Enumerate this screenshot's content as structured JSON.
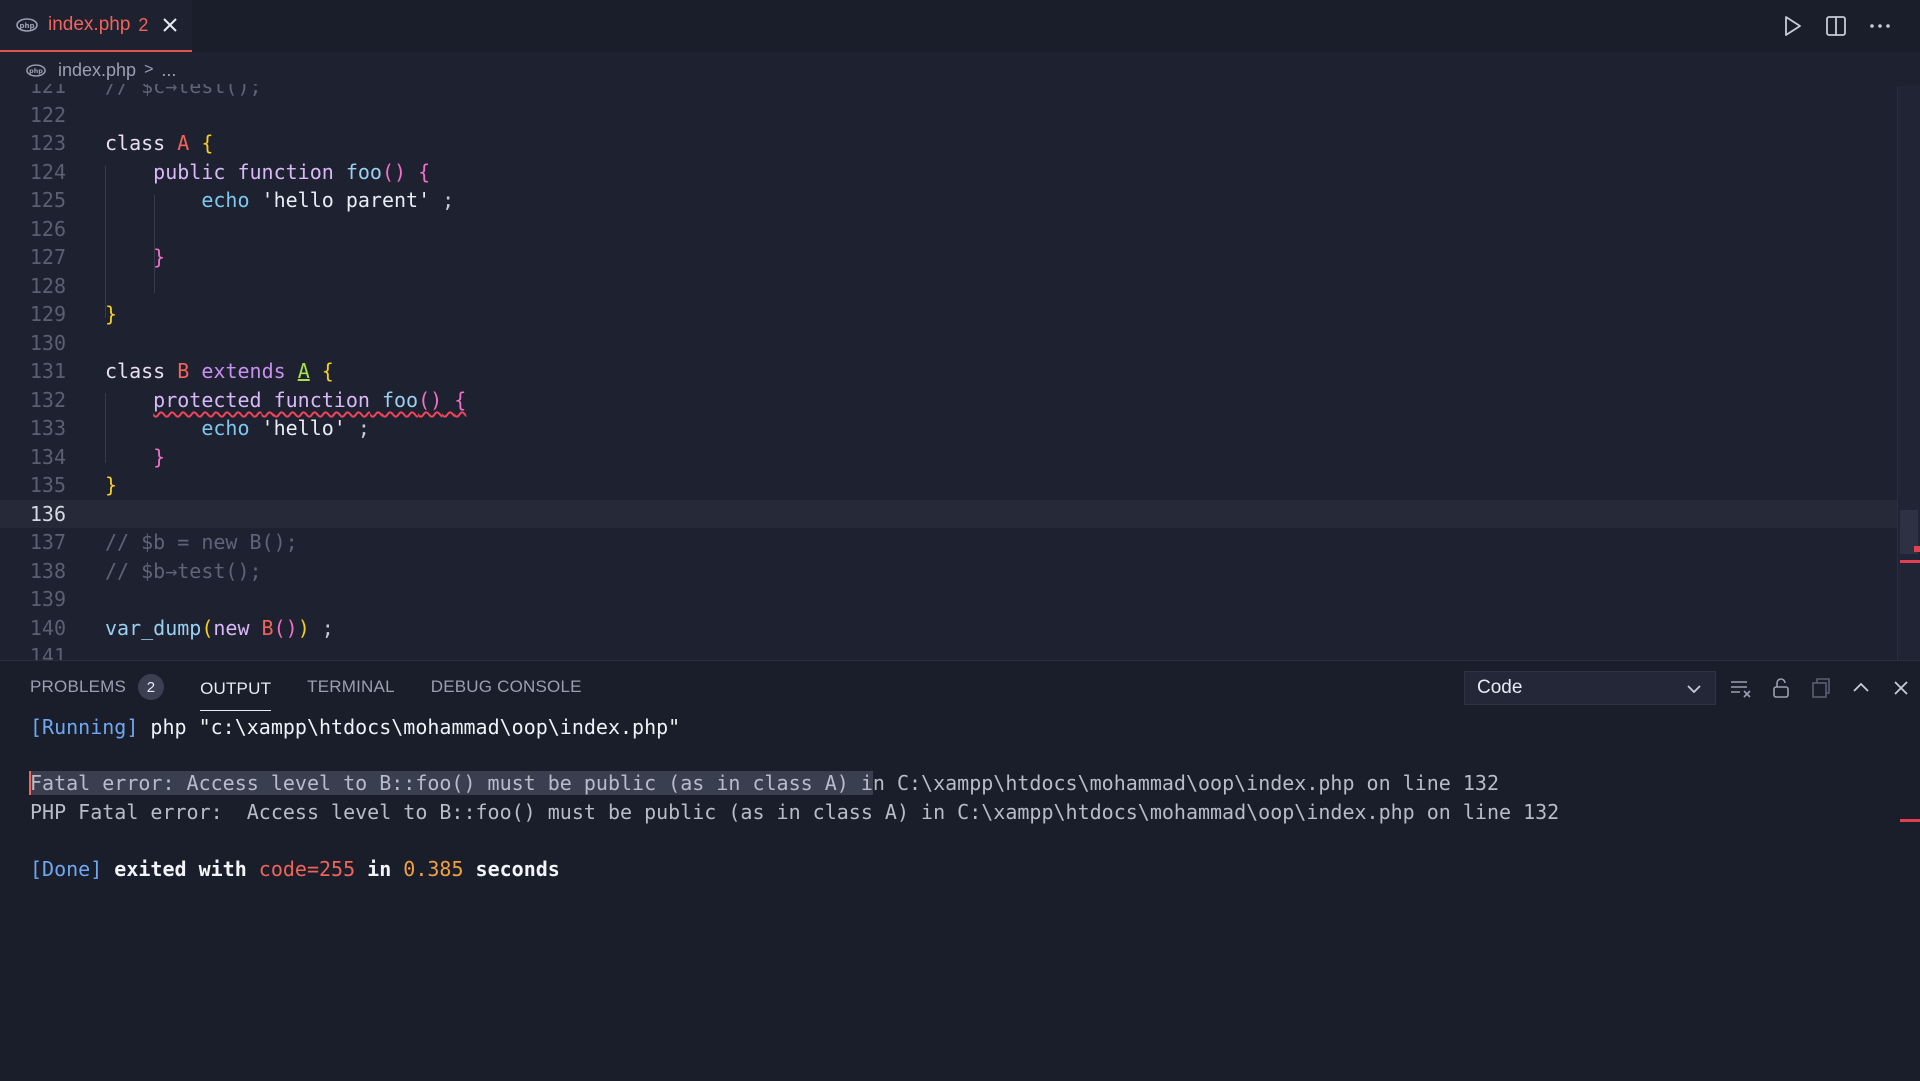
{
  "tab": {
    "file": "index.php",
    "count": "2"
  },
  "breadcrumb": {
    "file": "index.php",
    "sep": ">",
    "more": "..."
  },
  "editor": {
    "lines": [
      {
        "n": "121",
        "text": "// $c→test();"
      },
      {
        "n": "122",
        "text": ""
      },
      {
        "n": "123",
        "text": "class A {"
      },
      {
        "n": "124",
        "text": "public function foo() {"
      },
      {
        "n": "125",
        "text": "echo 'hello parent' ;"
      },
      {
        "n": "126",
        "text": ""
      },
      {
        "n": "127",
        "text": "}"
      },
      {
        "n": "128",
        "text": ""
      },
      {
        "n": "129",
        "text": "}"
      },
      {
        "n": "130",
        "text": ""
      },
      {
        "n": "131",
        "text": "class B extends A {"
      },
      {
        "n": "132",
        "text": "protected function foo() {"
      },
      {
        "n": "133",
        "text": "echo 'hello' ;"
      },
      {
        "n": "134",
        "text": "}"
      },
      {
        "n": "135",
        "text": "}"
      },
      {
        "n": "136",
        "text": ""
      },
      {
        "n": "137",
        "text": "// $b = new B();"
      },
      {
        "n": "138",
        "text": "// $b→test();"
      },
      {
        "n": "139",
        "text": ""
      },
      {
        "n": "140",
        "text": "var_dump(new B()) ;"
      },
      {
        "n": "141",
        "text": ""
      }
    ]
  },
  "panel": {
    "tabs": {
      "problems": "PROBLEMS",
      "problems_count": "2",
      "output": "OUTPUT",
      "terminal": "TERMINAL",
      "debug": "DEBUG CONSOLE"
    },
    "select_value": "Code",
    "output": {
      "running_tag": "[Running]",
      "running_cmd": " php \"c:\\xampp\\htdocs\\mohammad\\oop\\index.php\"",
      "fatal_sel": "Fatal error: Access level to B::foo() must be public (as in class A) i",
      "fatal_rest": "n C:\\xampp\\htdocs\\mohammad\\oop\\index.php on line 132",
      "php_fatal": "PHP Fatal error:  Access level to B::foo() must be public (as in class A) in C:\\xampp\\htdocs\\mohammad\\oop\\index.php on line 132",
      "done_tag": "[Done]",
      "done_exited": " exited with ",
      "done_code": "code=255",
      "done_in": " in ",
      "done_secs": "0.385",
      "done_seconds": " seconds"
    }
  },
  "icons": {
    "php": "php-file-icon",
    "close": "close-icon",
    "run": "run-icon",
    "split": "split-editor-icon",
    "more": "more-actions-icon",
    "chevron": "chevron-down-icon",
    "clear": "clear-output-icon",
    "lock": "lock-scroll-icon",
    "copy": "open-output-editor-icon",
    "max": "maximize-panel-icon",
    "pclose": "close-panel-icon"
  },
  "colors": {
    "accent": "#f0645a",
    "background": "#1e2130",
    "panel": "#1a1d2a"
  }
}
